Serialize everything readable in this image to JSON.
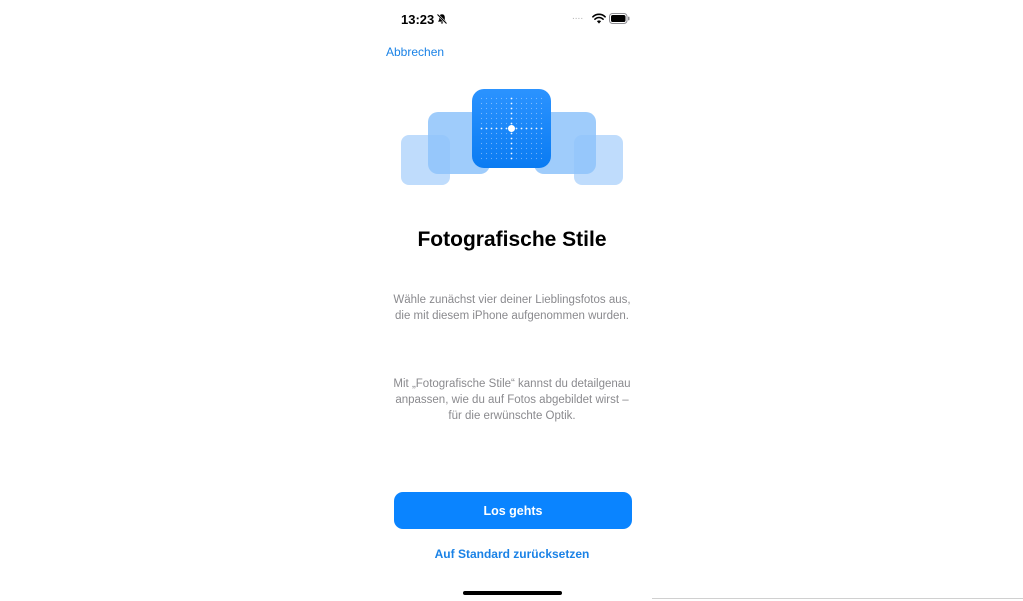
{
  "status_bar": {
    "time": "13:23",
    "signal_text": "....",
    "icons": [
      "bell-slash-icon",
      "wifi-icon",
      "battery-icon"
    ]
  },
  "nav": {
    "cancel_label": "Abbrechen"
  },
  "hero": {
    "icon": "photographic-styles-grid-icon",
    "accent_color": "#0a84ff"
  },
  "content": {
    "title": "Fotografische Stile",
    "paragraph_1": "Wähle zunächst vier deiner Lieblingsfotos aus, die mit diesem iPhone aufgenommen wurden.",
    "paragraph_2": "Mit „Fotografische Stile“ kannst du detailgenau anpassen, wie du auf Fotos abgebildet wirst – für die erwünschte Optik."
  },
  "actions": {
    "primary_label": "Los gehts",
    "secondary_label": "Auf Standard zurücksetzen"
  },
  "colors": {
    "accent": "#0a84ff",
    "link": "#1a82e6",
    "secondary_text": "#8a8a8e"
  }
}
